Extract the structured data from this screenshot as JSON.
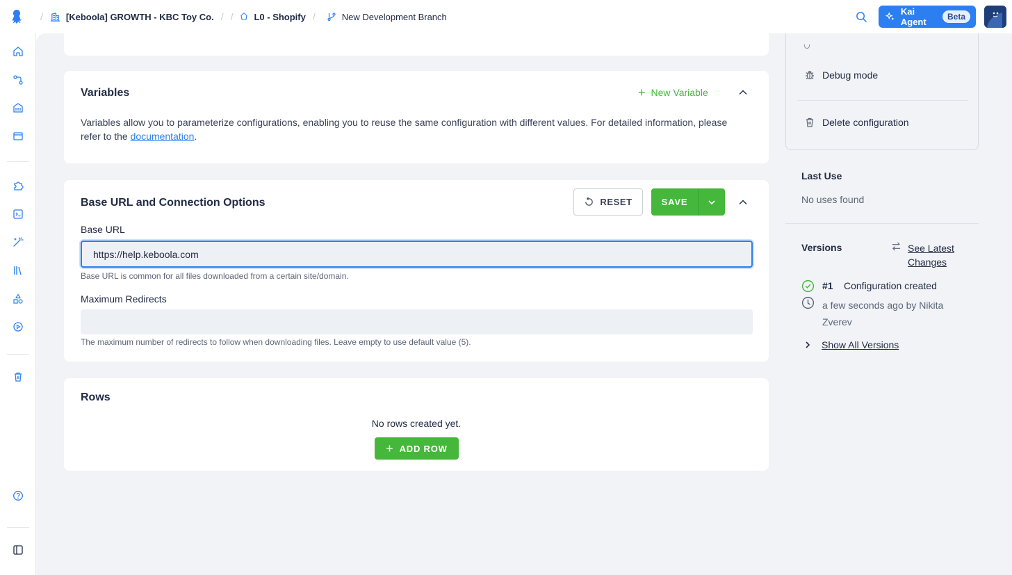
{
  "topbar": {
    "breadcrumbs": [
      {
        "label": "[Keboola] GROWTH - KBC Toy Co."
      },
      {
        "label": "L0 - Shopify"
      },
      {
        "label": "New Development Branch"
      }
    ],
    "kai_label": "Kai Agent",
    "kai_badge": "Beta"
  },
  "variables": {
    "title": "Variables",
    "new_variable": "New Variable",
    "description": "Variables allow you to parameterize configurations, enabling you to reuse the same configuration with different values. For detailed information, please refer to the",
    "doc_link": "documentation",
    "period": "."
  },
  "base_url_section": {
    "title": "Base URL and Connection Options",
    "reset_label": "RESET",
    "save_label": "SAVE",
    "base_url_label": "Base URL",
    "base_url_value": "https://help.keboola.com",
    "base_url_help": "Base URL is common for all files downloaded from a certain site/domain.",
    "redirects_label": "Maximum Redirects",
    "redirects_value": "",
    "redirects_help": "The maximum number of redirects to follow when downloading files. Leave empty to use default value (5)."
  },
  "rows": {
    "title": "Rows",
    "empty_text": "No rows created yet.",
    "add_row": "ADD ROW"
  },
  "right_panel": {
    "debug_mode": "Debug mode",
    "delete_config": "Delete configuration",
    "last_use_title": "Last Use",
    "last_use_text": "No uses found",
    "versions_title": "Versions",
    "see_latest_1": "See Latest",
    "see_latest_2": "Changes",
    "version_number": "#1",
    "version_desc": "Configuration created",
    "version_time_1": "a few seconds ago by Nikita",
    "version_time_2": "Zverev",
    "show_all": "Show All Versions"
  },
  "colors": {
    "accent_blue": "#2c7ff0",
    "green": "#45b83b",
    "background": "#f1f3f6"
  }
}
